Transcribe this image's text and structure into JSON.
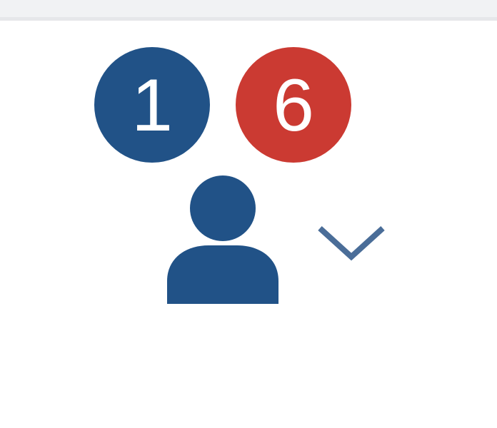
{
  "notifications": {
    "primary_count": "1",
    "alert_count": "6"
  },
  "icons": {
    "avatar": "user-icon",
    "dropdown": "chevron-down-icon"
  },
  "colors": {
    "primary": "#215287",
    "alert": "#cb3a32",
    "chevron": "#4a6d98",
    "background": "#ffffff",
    "top_strip": "#f1f2f4"
  }
}
